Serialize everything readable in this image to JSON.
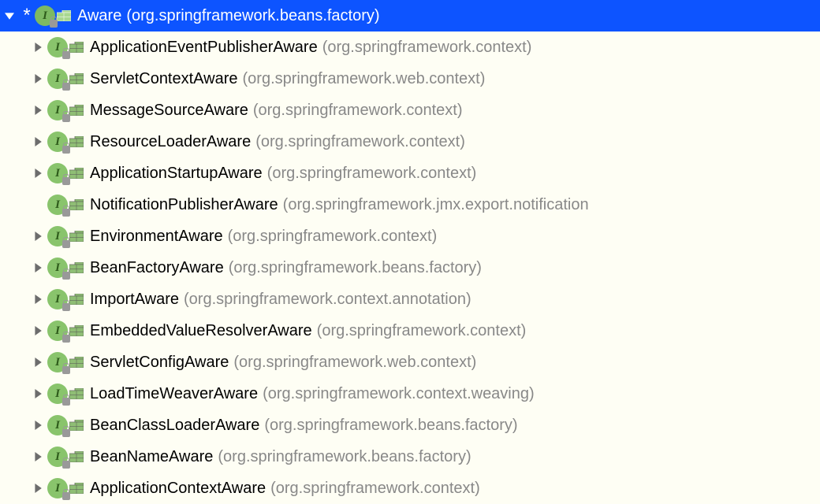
{
  "root": {
    "name": "Aware",
    "package": "(org.springframework.beans.factory)",
    "expanded": true,
    "star": "*"
  },
  "children": [
    {
      "name": "ApplicationEventPublisherAware",
      "package": "(org.springframework.context)",
      "hasChildren": true
    },
    {
      "name": "ServletContextAware",
      "package": "(org.springframework.web.context)",
      "hasChildren": true
    },
    {
      "name": "MessageSourceAware",
      "package": "(org.springframework.context)",
      "hasChildren": true
    },
    {
      "name": "ResourceLoaderAware",
      "package": "(org.springframework.context)",
      "hasChildren": true
    },
    {
      "name": "ApplicationStartupAware",
      "package": "(org.springframework.context)",
      "hasChildren": true
    },
    {
      "name": "NotificationPublisherAware",
      "package": "(org.springframework.jmx.export.notification",
      "hasChildren": false
    },
    {
      "name": "EnvironmentAware",
      "package": "(org.springframework.context)",
      "hasChildren": true
    },
    {
      "name": "BeanFactoryAware",
      "package": "(org.springframework.beans.factory)",
      "hasChildren": true
    },
    {
      "name": "ImportAware",
      "package": "(org.springframework.context.annotation)",
      "hasChildren": true
    },
    {
      "name": "EmbeddedValueResolverAware",
      "package": "(org.springframework.context)",
      "hasChildren": true
    },
    {
      "name": "ServletConfigAware",
      "package": "(org.springframework.web.context)",
      "hasChildren": true
    },
    {
      "name": "LoadTimeWeaverAware",
      "package": "(org.springframework.context.weaving)",
      "hasChildren": true
    },
    {
      "name": "BeanClassLoaderAware",
      "package": "(org.springframework.beans.factory)",
      "hasChildren": true
    },
    {
      "name": "BeanNameAware",
      "package": "(org.springframework.beans.factory)",
      "hasChildren": true
    },
    {
      "name": "ApplicationContextAware",
      "package": "(org.springframework.context)",
      "hasChildren": true
    }
  ],
  "interface_letter": "I"
}
